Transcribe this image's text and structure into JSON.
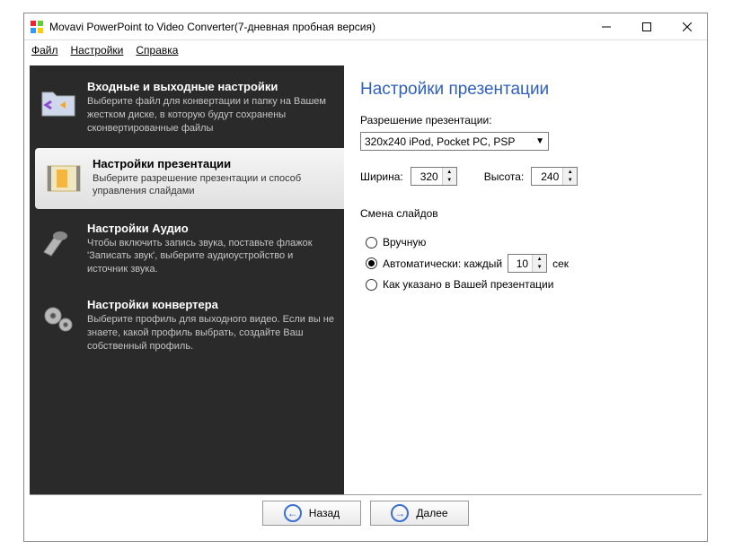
{
  "window": {
    "title": "Movavi PowerPoint to Video Converter(7-дневная пробная версия)"
  },
  "menu": {
    "file": "Файл",
    "settings": "Настройки",
    "help": "Справка"
  },
  "sidebar": {
    "items": [
      {
        "title": "Входные и выходные настройки",
        "desc": "Выберите файл для конвертации и папку на Вашем жестком диске, в которую будут сохранены сконвертированные файлы"
      },
      {
        "title": "Настройки презентации",
        "desc": "Выберите разрешение презентации и способ управления слайдами"
      },
      {
        "title": "Настройки Аудио",
        "desc": "Чтобы включить запись звука, поставьте флажок 'Записать звук', выберите аудиоустройство и источник звука."
      },
      {
        "title": "Настройки конвертера",
        "desc": "Выберите профиль для выходного видео. Если вы не знаете, какой профиль выбрать, создайте Ваш собственный профиль."
      }
    ]
  },
  "panel": {
    "heading": "Настройки презентации",
    "res_label": "Разрешение презентации:",
    "res_value": "320x240 iPod, Pocket PC, PSP",
    "width_label": "Ширина:",
    "width_value": "320",
    "height_label": "Высота:",
    "height_value": "240",
    "slides_label": "Смена слайдов",
    "opt_manual": "Вручную",
    "opt_auto_prefix": "Автоматически: каждый",
    "opt_auto_seconds": "10",
    "opt_auto_suffix": "сек",
    "opt_as_is": "Как указано в Вашей презентации"
  },
  "footer": {
    "back": "Назад",
    "next": "Далее"
  }
}
